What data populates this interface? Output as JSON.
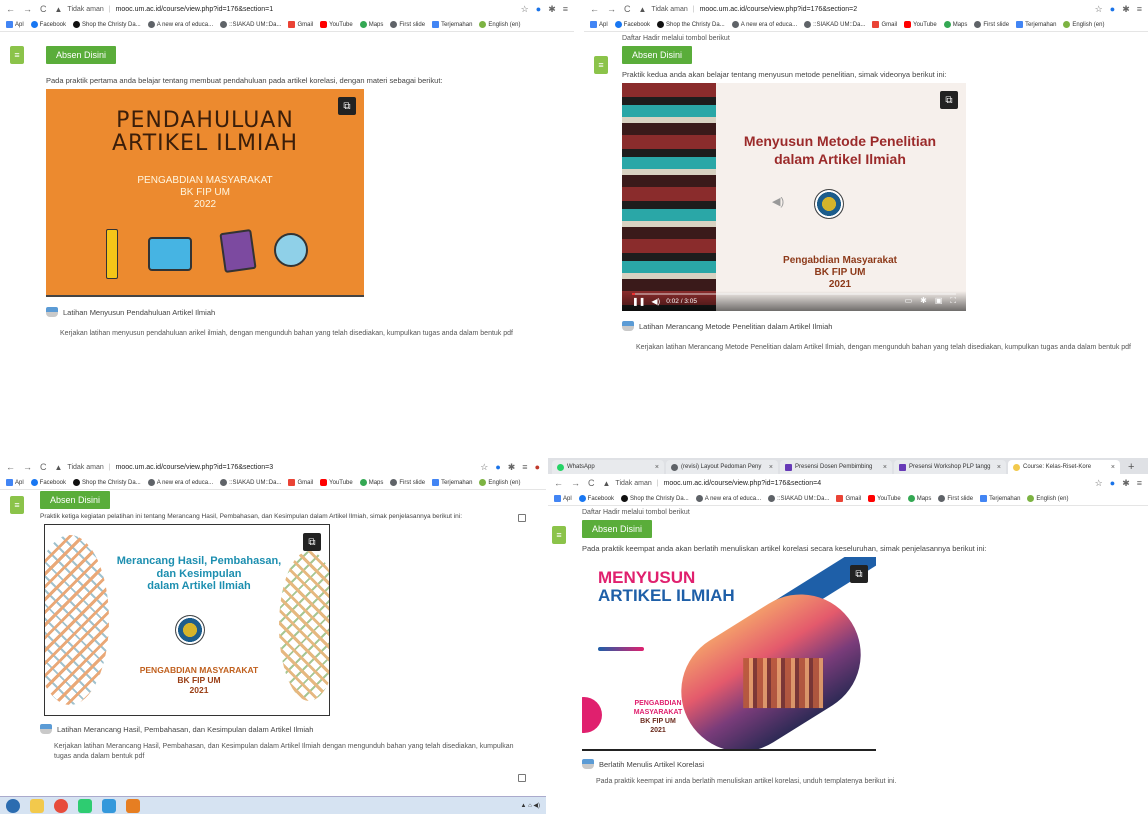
{
  "bookmarks": [
    "Apl",
    "Facebook",
    "Shop the Christy Da...",
    "A new era of educa...",
    "::SIAKAD UM::Da...",
    "Gmail",
    "YouTube",
    "Maps",
    "First slide",
    "Terjemahan",
    "English (en)"
  ],
  "insecure_label": "Tidak aman",
  "absen_label": "Absen Disini",
  "hadir_hint": "Daftar Hadir melalui tombol berikut",
  "colors": {
    "absen_green": "#5aad3a",
    "side_icon_green": "#8bc34a",
    "link_blue": "#1a73e8"
  },
  "panes": [
    {
      "url": "mooc.um.ac.id/course/view.php?id=176&section=1",
      "description": "Pada praktik pertama anda belajar tentang membuat pendahuluan pada artikel korelasi, dengan materi sebagai berikut:",
      "slide": {
        "title_line1": "PENDAHULUAN",
        "title_line2": "ARTIKEL ILMIAH",
        "sub1": "PENGABDIAN MASYARAKAT",
        "sub2": "BK FIP UM",
        "sub3": "2022"
      },
      "activity": "Latihan Menyusun Pendahuluan Artikel Ilmiah",
      "activity_desc": "Kerjakan latihan menyusun pendahuluan arikel ilmiah, dengan mengunduh bahan yang telah disediakan, kumpulkan tugas anda dalam bentuk pdf"
    },
    {
      "url": "mooc.um.ac.id/course/view.php?id=176&section=2",
      "description": "Praktik kedua anda akan belajar tentang menyusun metode penelitian, simak videonya berikut ini:",
      "slide": {
        "title_line1": "Menyusun Metode Penelitian",
        "title_line2": "dalam Artikel Ilmiah",
        "sub1": "Pengabdian Masyarakat",
        "sub2": "BK FIP UM",
        "sub3": "2021"
      },
      "video": {
        "time": "0:02 / 3:05",
        "progress": 0.01
      },
      "activity": "Latihan Merancang Metode Penelitian dalam Artikel Ilmiah",
      "activity_desc": "Kerjakan latihan Merancang Metode Penelitian dalam Artikel Ilmiah, dengan mengunduh bahan yang telah disediakan, kumpulkan tugas anda dalam bentuk pdf"
    },
    {
      "url": "mooc.um.ac.id/course/view.php?id=176&section=3",
      "description": "Praktik ketiga kegiatan pelatihan ini tentang Merancang Hasil, Pembahasan, dan Kesimpulan dalam Artikel Ilmiah, simak penjelasannya berikut ini:",
      "slide": {
        "title_line1": "Merancang Hasil, Pembahasan,",
        "title_line2": "dan Kesimpulan",
        "title_line3": "dalam Artikel Ilmiah",
        "sub1": "PENGABDIAN MASYARAKAT",
        "sub2": "BK FIP UM",
        "sub3": "2021"
      },
      "activity": "Latihan Merancang Hasil, Pembahasan, dan Kesimpulan dalam Artikel Ilmiah",
      "activity_desc": "Kerjakan latihan Merancang Hasil, Pembahasan, dan Kesimpulan dalam Artikel Ilmiah dengan mengunduh bahan yang telah disediakan, kumpulkan tugas anda dalam bentuk pdf"
    },
    {
      "url": "mooc.um.ac.id/course/view.php?id=176&section=4",
      "tabs": [
        "WhatsApp",
        "(revisi) Layout Pedoman Peny",
        "Presensi Dosen Pembimbing",
        "Presensi Workshop PLP tangg",
        "Course: Kelas-Riset-Kore"
      ],
      "description": "Pada praktik keempat anda akan berlatih menuliskan artikel korelasi secara keseluruhan, simak penjelasannya berikut ini:",
      "slide": {
        "title_line1": "MENYUSUN",
        "title_line2": "ARTIKEL ILMIAH",
        "sub1": "PENGABDIAN MASYARAKAT",
        "sub2": "BK FIP UM",
        "sub3": "2021"
      },
      "activity": "Berlatih Menulis Artikel Korelasi",
      "activity_desc": "Pada praktik keempat ini anda berlatih menuliskan artikel korelasi, unduh templatenya berikut ini."
    }
  ]
}
